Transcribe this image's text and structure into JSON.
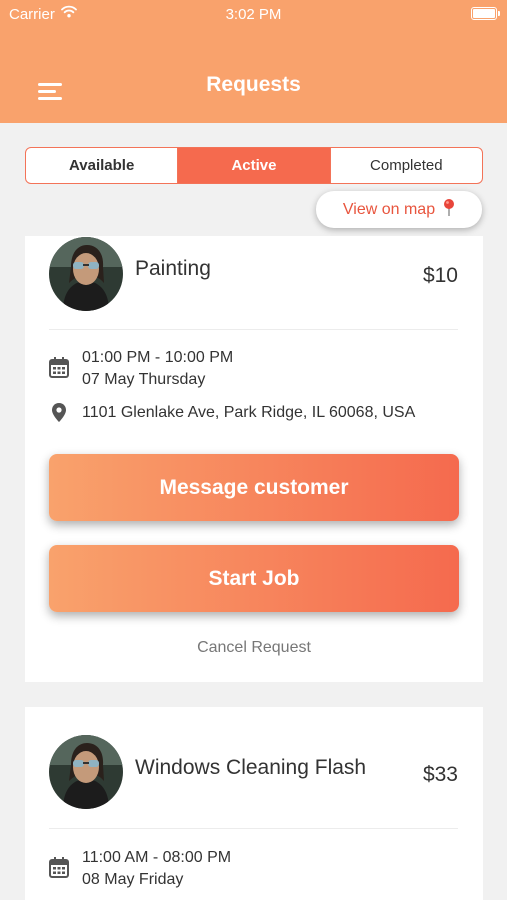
{
  "status_bar": {
    "carrier": "Carrier",
    "time": "3:02 PM"
  },
  "header": {
    "title": "Requests",
    "menu_icon": "hamburger-menu-icon"
  },
  "tabs": [
    {
      "label": "Available"
    },
    {
      "label": "Active",
      "selected": true
    },
    {
      "label": "Completed"
    }
  ],
  "map_button": {
    "label": "View on map",
    "icon": "map-pin-icon"
  },
  "requests": [
    {
      "title": "Painting",
      "price": "$10",
      "time": "01:00 PM - 10:00 PM",
      "date": "07 May Thursday",
      "address": "1101 Glenlake Ave, Park Ridge, IL 60068, USA",
      "message_label": "Message customer",
      "start_label": "Start Job",
      "cancel_label": "Cancel Request"
    },
    {
      "title": "Windows Cleaning Flash",
      "price": "$33",
      "time": "11:00 AM - 08:00 PM",
      "date": "08 May Friday"
    }
  ],
  "colors": {
    "primary": "#f9a26c",
    "accent": "#f56a4e",
    "background": "#f1f1f1"
  }
}
